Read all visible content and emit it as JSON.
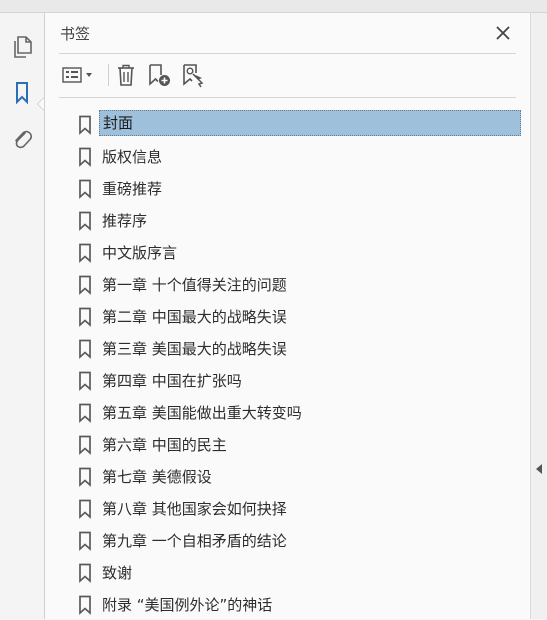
{
  "panel": {
    "title": "书签",
    "close_label": "关闭"
  },
  "left_toolbar": [
    {
      "name": "pages-thumbnail-icon"
    },
    {
      "name": "bookmark-panel-icon"
    },
    {
      "name": "attachment-icon"
    }
  ],
  "toolbar": {
    "options": "options-icon",
    "delete": "trash-icon",
    "new_bookmark": "new-bookmark-icon",
    "find_bookmark": "find-bookmark-icon"
  },
  "bookmarks": [
    {
      "label": "封面",
      "selected": true
    },
    {
      "label": "版权信息"
    },
    {
      "label": "重磅推荐"
    },
    {
      "label": "推荐序"
    },
    {
      "label": "中文版序言"
    },
    {
      "label": "第一章 十个值得关注的问题"
    },
    {
      "label": "第二章 中国最大的战略失误"
    },
    {
      "label": "第三章 美国最大的战略失误"
    },
    {
      "label": "第四章 中国在扩张吗"
    },
    {
      "label": "第五章 美国能做出重大转变吗"
    },
    {
      "label": "第六章 中国的民主"
    },
    {
      "label": "第七章 美德假设"
    },
    {
      "label": "第八章 其他国家会如何抉择"
    },
    {
      "label": "第九章 一个自相矛盾的结论"
    },
    {
      "label": "致谢"
    },
    {
      "label": "附录 “美国例外论”的神话"
    }
  ],
  "colors": {
    "selection": "#9ec0da",
    "accent_icon": "#2a6fb5"
  }
}
